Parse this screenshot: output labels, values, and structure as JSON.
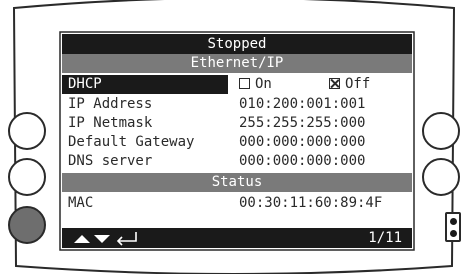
{
  "status": {
    "title": "Stopped"
  },
  "sections": {
    "ethernet": "Ethernet/IP",
    "status": "Status"
  },
  "dhcp": {
    "label": "DHCP",
    "on_label": "On",
    "off_label": "Off",
    "selected": "Off"
  },
  "rows": [
    {
      "label": "IP Address",
      "value": "010:200:001:001"
    },
    {
      "label": "IP Netmask",
      "value": "255:255:255:000"
    },
    {
      "label": "Default Gateway",
      "value": "000:000:000:000"
    },
    {
      "label": "DNS server",
      "value": "000:000:000:000"
    }
  ],
  "mac": {
    "label": "MAC",
    "value": "00:30:11:60:89:4F"
  },
  "footer": {
    "page": "1/11",
    "nav_icons": [
      "up-arrow-icon",
      "down-arrow-icon",
      "enter-icon"
    ]
  },
  "colors": {
    "bar_dark": "#1a1a1a",
    "section_gray": "#7a7a7a",
    "text": "#2a2a2a"
  }
}
